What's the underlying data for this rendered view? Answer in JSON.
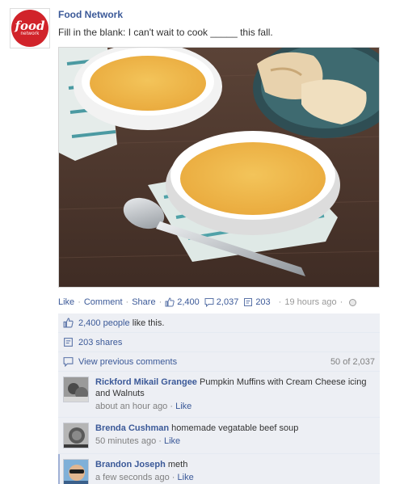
{
  "post": {
    "page_name": "Food Network",
    "avatar_logo_word": "food",
    "avatar_logo_sub": "network",
    "message": "Fill in the blank: I can't wait to cook _____ this fall.",
    "photo_icon": "soup-photo"
  },
  "actions": {
    "like": "Like",
    "comment": "Comment",
    "share": "Share",
    "likes_count": "2,400",
    "comments_count": "2,037",
    "shares_count": "203",
    "timestamp": "19 hours ago",
    "separator": "·",
    "privacy_icon": "globe-icon"
  },
  "ufi": {
    "likes_link": "2,400 people",
    "likes_suffix": "like this.",
    "shares_text": "203 shares",
    "view_previous": "View previous comments",
    "comment_count_text": "50 of 2,037"
  },
  "comments": [
    {
      "author": "Rickford Mikail Grangee",
      "text": "Pumpkin Muffins with Cream Cheese icing and Walnuts",
      "time": "about an hour ago",
      "like": "Like"
    },
    {
      "author": "Brenda Cushman",
      "text": "homemade vegatable beef soup",
      "time": "50 minutes ago",
      "like": "Like"
    },
    {
      "author": "Brandon Joseph",
      "text": "meth",
      "time": "a few seconds ago",
      "like": "Like"
    }
  ],
  "colors": {
    "link": "#3b5998",
    "ufi_bg": "#edeff4",
    "brand_red": "#d1232a"
  }
}
